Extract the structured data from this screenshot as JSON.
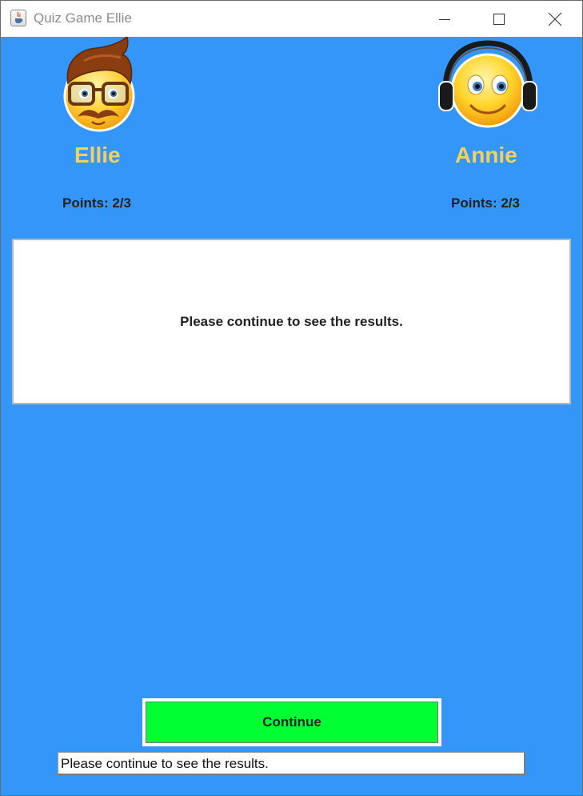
{
  "window": {
    "title": "Quiz Game Ellie",
    "icon": "java-coffee-cup-icon",
    "controls": [
      "minimize-icon",
      "maximize-icon",
      "close-icon"
    ]
  },
  "colors": {
    "background": "#3596fa",
    "name_color": "#f5d05a",
    "continue_button": "#00ff33",
    "panel": "#ffffff"
  },
  "players": [
    {
      "name": "Ellie",
      "avatar": "hipster-emoji-icon",
      "points": "Points: 2/3"
    },
    {
      "name": "Annie",
      "avatar": "headphones-emoji-icon",
      "points": "Points: 2/3"
    }
  ],
  "message": "Please continue to see the results.",
  "continue_label": "Continue",
  "status_text": "Please continue to see the results."
}
